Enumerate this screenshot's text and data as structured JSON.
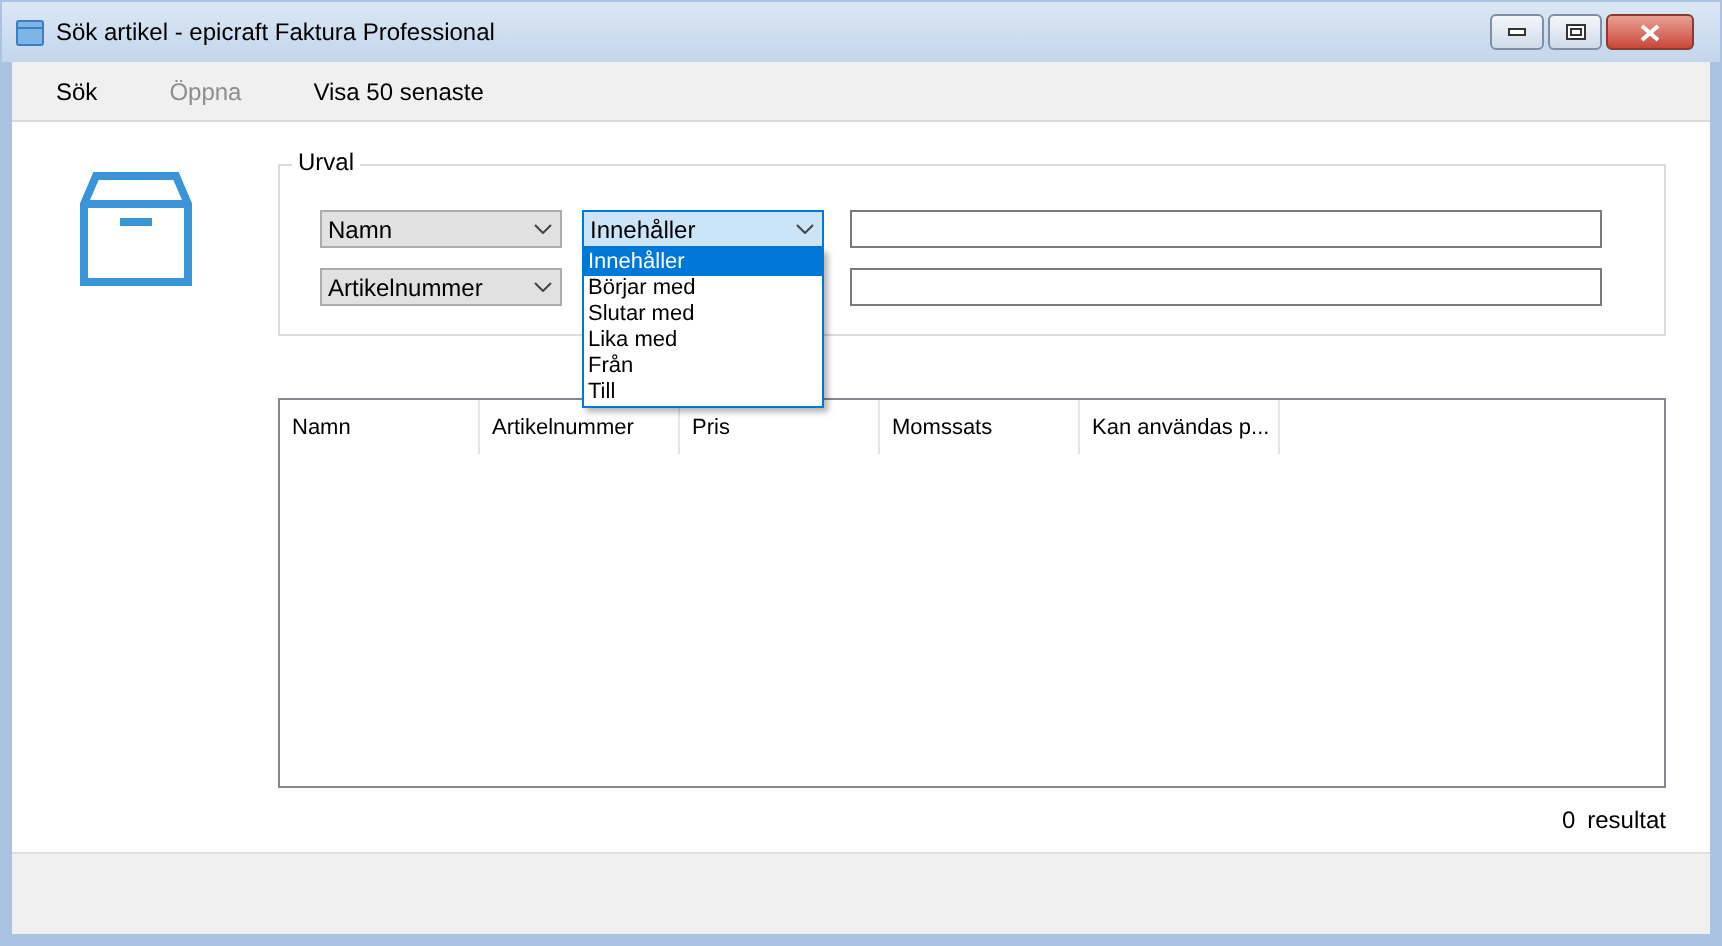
{
  "window": {
    "title": "Sök artikel - epicraft Faktura Professional"
  },
  "toolbar": [
    {
      "label": "Sök",
      "disabled": false
    },
    {
      "label": "Öppna",
      "disabled": true
    },
    {
      "label": "Visa 50 senaste",
      "disabled": false
    }
  ],
  "selection": {
    "legend": "Urval",
    "rows": [
      {
        "field": "Namn",
        "operator": {
          "value": "Innehåller",
          "expanded": true,
          "options": [
            {
              "label": "Innehåller",
              "selected": true
            },
            {
              "label": "Börjar med",
              "selected": false
            },
            {
              "label": "Slutar med",
              "selected": false
            },
            {
              "label": "Lika med",
              "selected": false
            },
            {
              "label": "Från",
              "selected": false
            },
            {
              "label": "Till",
              "selected": false
            }
          ]
        }
      },
      {
        "field": "Artikelnummer"
      }
    ]
  },
  "table": {
    "columns": [
      "Namn",
      "Artikelnummer",
      "Pris",
      "Momssats",
      "Kan användas p..."
    ]
  },
  "result": {
    "count": "0",
    "label": "resultat"
  }
}
